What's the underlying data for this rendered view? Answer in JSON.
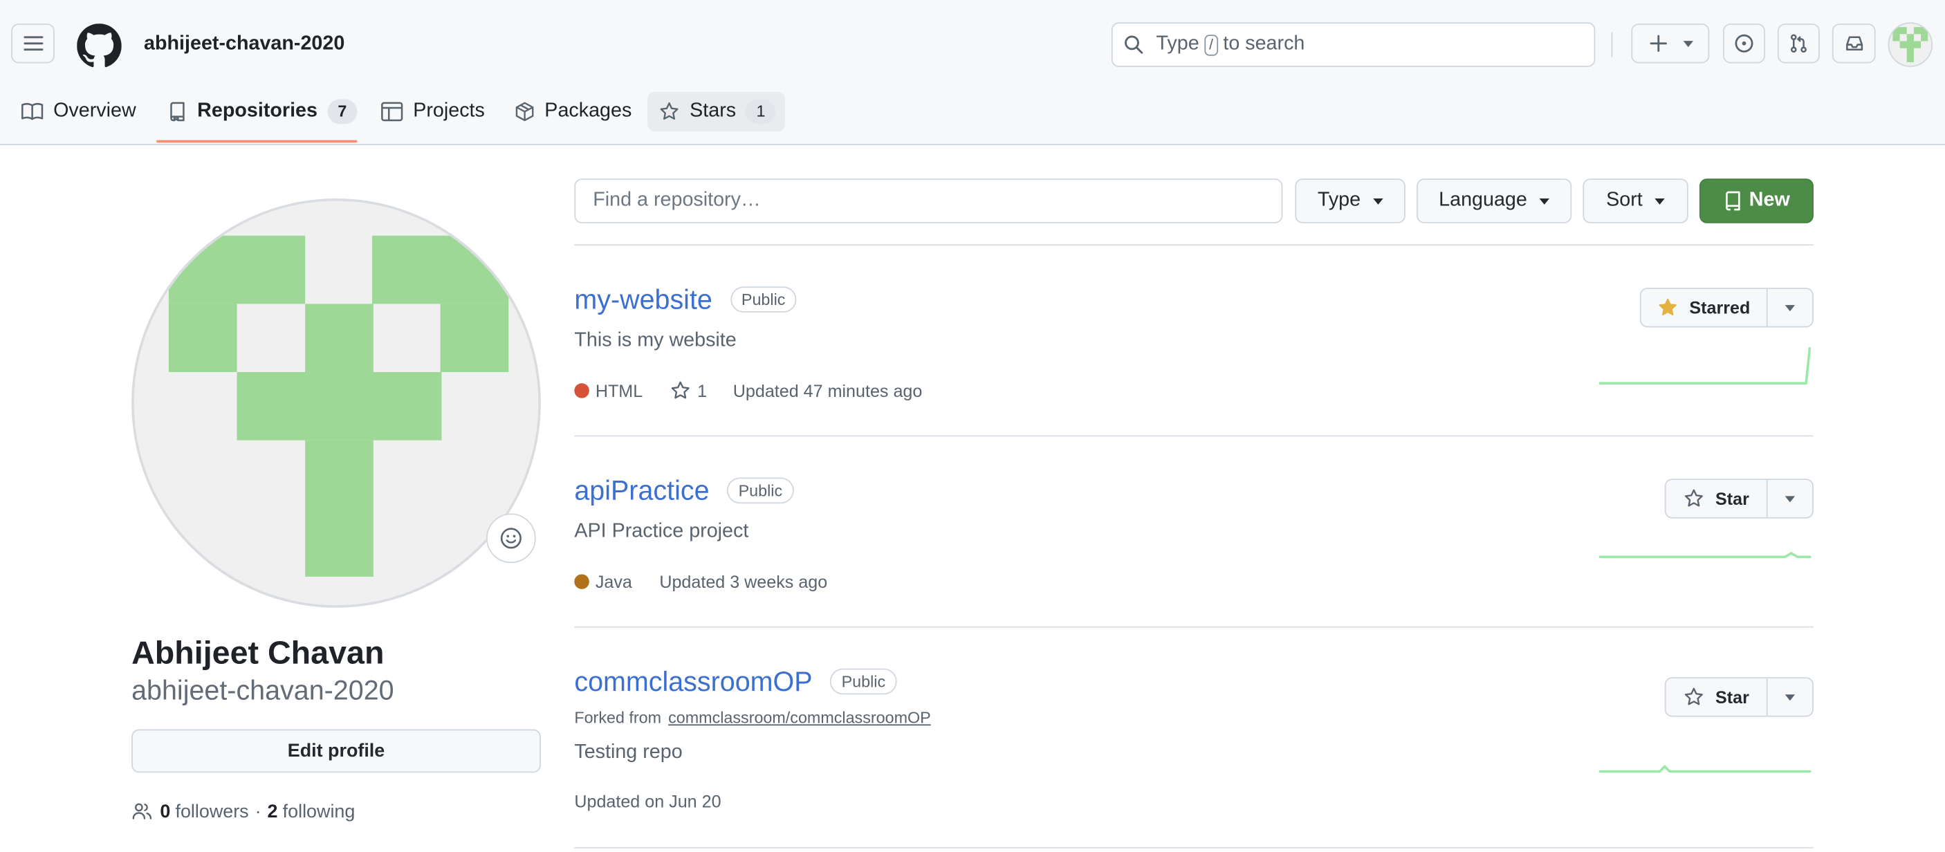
{
  "header": {
    "username": "abhijeet-chavan-2020",
    "search_placeholder": "Type / to search",
    "search_prefix": "Type",
    "search_key": "/",
    "search_suffix": "to search"
  },
  "tabs": [
    {
      "label": "Overview"
    },
    {
      "label": "Repositories",
      "count": "7",
      "selected": true
    },
    {
      "label": "Projects"
    },
    {
      "label": "Packages"
    },
    {
      "label": "Stars",
      "count": "1"
    }
  ],
  "profile": {
    "full_name": "Abhijeet Chavan",
    "username": "abhijeet-chavan-2020",
    "edit_label": "Edit profile",
    "followers_count": "0",
    "followers_label": "followers",
    "separator": "·",
    "following_count": "2",
    "following_label": "following"
  },
  "filters": {
    "search_placeholder": "Find a repository…",
    "type_label": "Type",
    "language_label": "Language",
    "sort_label": "Sort",
    "new_label": "New"
  },
  "repos": [
    {
      "name": "my-website",
      "visibility": "Public",
      "description": "This is my website",
      "language": "HTML",
      "language_color": "#e34c26",
      "stars": "1",
      "updated": "Updated 47 minutes ago",
      "star_label": "Starred"
    },
    {
      "name": "apiPractice",
      "visibility": "Public",
      "description": "API Practice project",
      "language": "Java",
      "language_color": "#b07219",
      "updated": "Updated 3 weeks ago",
      "star_label": "Star"
    },
    {
      "name": "commclassroomOP",
      "visibility": "Public",
      "forked_prefix": "Forked from",
      "forked_from": "commclassroom/commclassroomOP",
      "description": "Testing repo",
      "updated": "Updated on Jun 20",
      "star_label": "Star"
    }
  ],
  "colors": {
    "accent_tab_underline": "#fd8c73",
    "new_button": "#4c8c47",
    "link": "#3b6fd1",
    "avatar_green": "#9dd896",
    "sparkline": "#9be9a8",
    "starred_icon": "#e3b341"
  }
}
